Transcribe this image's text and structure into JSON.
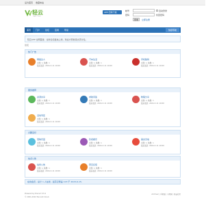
{
  "topbar": {
    "left": "设为首页",
    "right": "收藏本站"
  },
  "logo": {
    "name": "轻云",
    "sub": "Light Cloud"
  },
  "header": {
    "app_label": "APP 扫码下载",
    "username_label": "帐号",
    "password_label": "密码",
    "remember_label": "自动登录",
    "forgot_label": "找回密码",
    "register_label": "立即注册",
    "login_label": "登录"
  },
  "nav": {
    "items": [
      {
        "label": "首页"
      },
      {
        "label": "门户"
      },
      {
        "label": "论坛"
      },
      {
        "label": "应用"
      },
      {
        "label": "导读"
      }
    ],
    "right_label": "快捷导航"
  },
  "notice": {
    "text": "轻云APP 全网首发：全新论坛板块上线，欢迎大家前来交流讨论。"
  },
  "crumb": "论坛",
  "sections": [
    {
      "title": "热门广告",
      "forums": [
        {
          "title": "网络达人",
          "stat": "主题: 1, 帖数: 1",
          "last": "最后发表: 2024-3-11 10:09",
          "color": "#e87f2a"
        },
        {
          "title": "汽车生活",
          "stat": "主题: 1, 帖数: 1",
          "last": "最后发表: 2024-3-11 10:09",
          "color": "#d9534f"
        },
        {
          "title": "手机数码",
          "stat": "主题: 1, 帖数: 1",
          "last": "最后发表: 2024-3-11 10:09",
          "color": "#c9302c"
        }
      ]
    },
    {
      "title": "服务推荐",
      "forums": [
        {
          "title": "资源共享",
          "stat": "主题: 1, 帖数: 1",
          "last": "最后发表: 2024-3-11 10:09",
          "color": "#5cb85c"
        },
        {
          "title": "求助问答",
          "stat": "主题: 1, 帖数: 1",
          "last": "最后发表: 2024-3-11 10:09",
          "color": "#337ab7"
        },
        {
          "title": "教程分享",
          "stat": "主题: 1, 帖数: 1",
          "last": "最后发表: 2024-3-11 10:09",
          "color": "#d9534f"
        },
        {
          "title": "活动专区",
          "stat": "主题: 1, 帖数: 1",
          "last": "最后发表: 2024-3-11 10:09",
          "color": "#f0ad4e"
        }
      ]
    },
    {
      "title": "兴趣爱好",
      "forums": [
        {
          "title": "宠物乐园",
          "stat": "主题: 1, 帖数: 1",
          "last": "最后发表: 2024-3-11 10:09",
          "color": "#5bc0de"
        },
        {
          "title": "影视娱乐",
          "stat": "主题: 1, 帖数: 1",
          "last": "最后发表: 2024-3-11 10:09",
          "color": "#9b59b6"
        },
        {
          "title": "美食天地",
          "stat": "主题: 1, 帖数: 1",
          "last": "最后发表: 2024-3-11 10:09",
          "color": "#e74c3c"
        }
      ]
    },
    {
      "title": "站点公告",
      "forums": [
        {
          "title": "站务公告",
          "stat": "主题: 1, 帖数: 1",
          "last": "最后发表: 2024-3-11 10:09",
          "color": "#d9534f"
        },
        {
          "title": "意见反馈",
          "stat": "主题: 1, 帖数: 1",
          "last": "最后发表: 2024-3-11 10:09",
          "color": "#e87f2a"
        }
      ]
    }
  ],
  "online": {
    "text": "在线会员 - 总计 1 人在线 - 最高记录是 103 于 2023-6-15."
  },
  "footer": {
    "line1": "Powered by Discuz! X3.4",
    "line2": "© 2001-2024 Tencent Cloud.",
    "links": "Archiver | 手机版 | 小黑屋 | 轻云社区"
  }
}
